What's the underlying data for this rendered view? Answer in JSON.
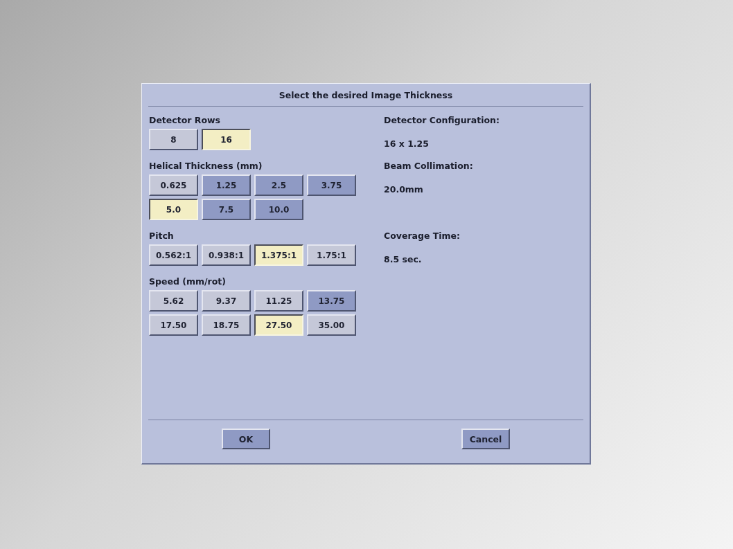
{
  "dialog": {
    "title": "Select the desired Image Thickness"
  },
  "sections": [
    {
      "label": "Detector Rows",
      "options": [
        {
          "label": "8",
          "selected": false,
          "disabled": false
        },
        {
          "label": "16",
          "selected": true,
          "disabled": false
        }
      ],
      "info": {
        "label": "Detector Configuration:",
        "value": "16 x 1.25"
      }
    },
    {
      "label": "Helical Thickness (mm)",
      "options": [
        {
          "label": "0.625",
          "selected": false,
          "disabled": false
        },
        {
          "label": "1.25",
          "selected": false,
          "disabled": true
        },
        {
          "label": "2.5",
          "selected": false,
          "disabled": true
        },
        {
          "label": "3.75",
          "selected": false,
          "disabled": true
        },
        {
          "label": "5.0",
          "selected": true,
          "disabled": false
        },
        {
          "label": "7.5",
          "selected": false,
          "disabled": true
        },
        {
          "label": "10.0",
          "selected": false,
          "disabled": true
        }
      ],
      "info": {
        "label": "Beam Collimation:",
        "value": "20.0mm"
      }
    },
    {
      "label": "Pitch",
      "options": [
        {
          "label": "0.562:1",
          "selected": false,
          "disabled": false
        },
        {
          "label": "0.938:1",
          "selected": false,
          "disabled": false
        },
        {
          "label": "1.375:1",
          "selected": true,
          "disabled": false
        },
        {
          "label": "1.75:1",
          "selected": false,
          "disabled": false
        }
      ],
      "info": {
        "label": "Coverage Time:",
        "value": "8.5 sec."
      }
    },
    {
      "label": "Speed (mm/rot)",
      "options": [
        {
          "label": "5.62",
          "selected": false,
          "disabled": false
        },
        {
          "label": "9.37",
          "selected": false,
          "disabled": false
        },
        {
          "label": "11.25",
          "selected": false,
          "disabled": false
        },
        {
          "label": "13.75",
          "selected": false,
          "disabled": true
        },
        {
          "label": "17.50",
          "selected": false,
          "disabled": false
        },
        {
          "label": "18.75",
          "selected": false,
          "disabled": false
        },
        {
          "label": "27.50",
          "selected": true,
          "disabled": false
        },
        {
          "label": "35.00",
          "selected": false,
          "disabled": false
        }
      ]
    }
  ],
  "buttons": [
    {
      "label": "OK"
    },
    {
      "label": "Cancel"
    }
  ]
}
